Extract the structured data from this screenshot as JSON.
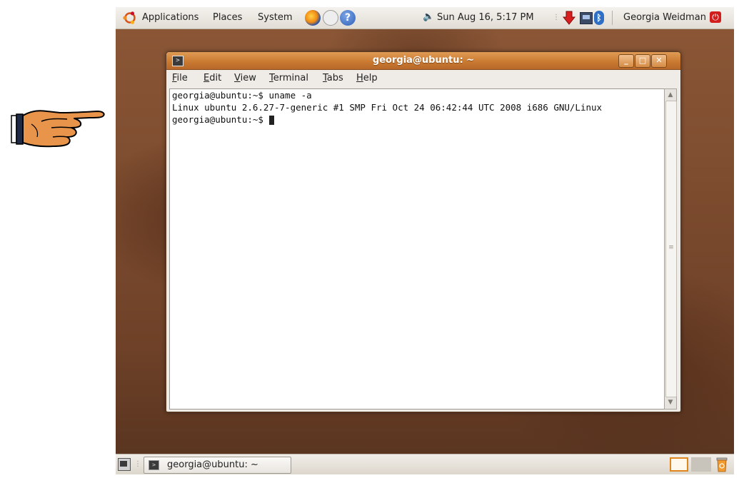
{
  "top_panel": {
    "menus": [
      "Applications",
      "Places",
      "System"
    ],
    "launchers": [
      "firefox-icon",
      "mail-icon",
      "help-icon"
    ],
    "clock": "Sun Aug 16,  5:17 PM",
    "user": "Georgia Weidman"
  },
  "window": {
    "title": "georgia@ubuntu: ~",
    "menu": [
      "File",
      "Edit",
      "View",
      "Terminal",
      "Tabs",
      "Help"
    ],
    "terminal_lines": [
      "georgia@ubuntu:~$ uname -a",
      "Linux ubuntu 2.6.27-7-generic #1 SMP Fri Oct 24 06:42:44 UTC 2008 i686 GNU/Linux",
      "georgia@ubuntu:~$ "
    ]
  },
  "taskbar": {
    "task_label": "georgia@ubuntu: ~"
  },
  "colors": {
    "titlebar": "#d5853f",
    "wallpaper": "#7a4a2e",
    "accent": "#e0861e"
  }
}
